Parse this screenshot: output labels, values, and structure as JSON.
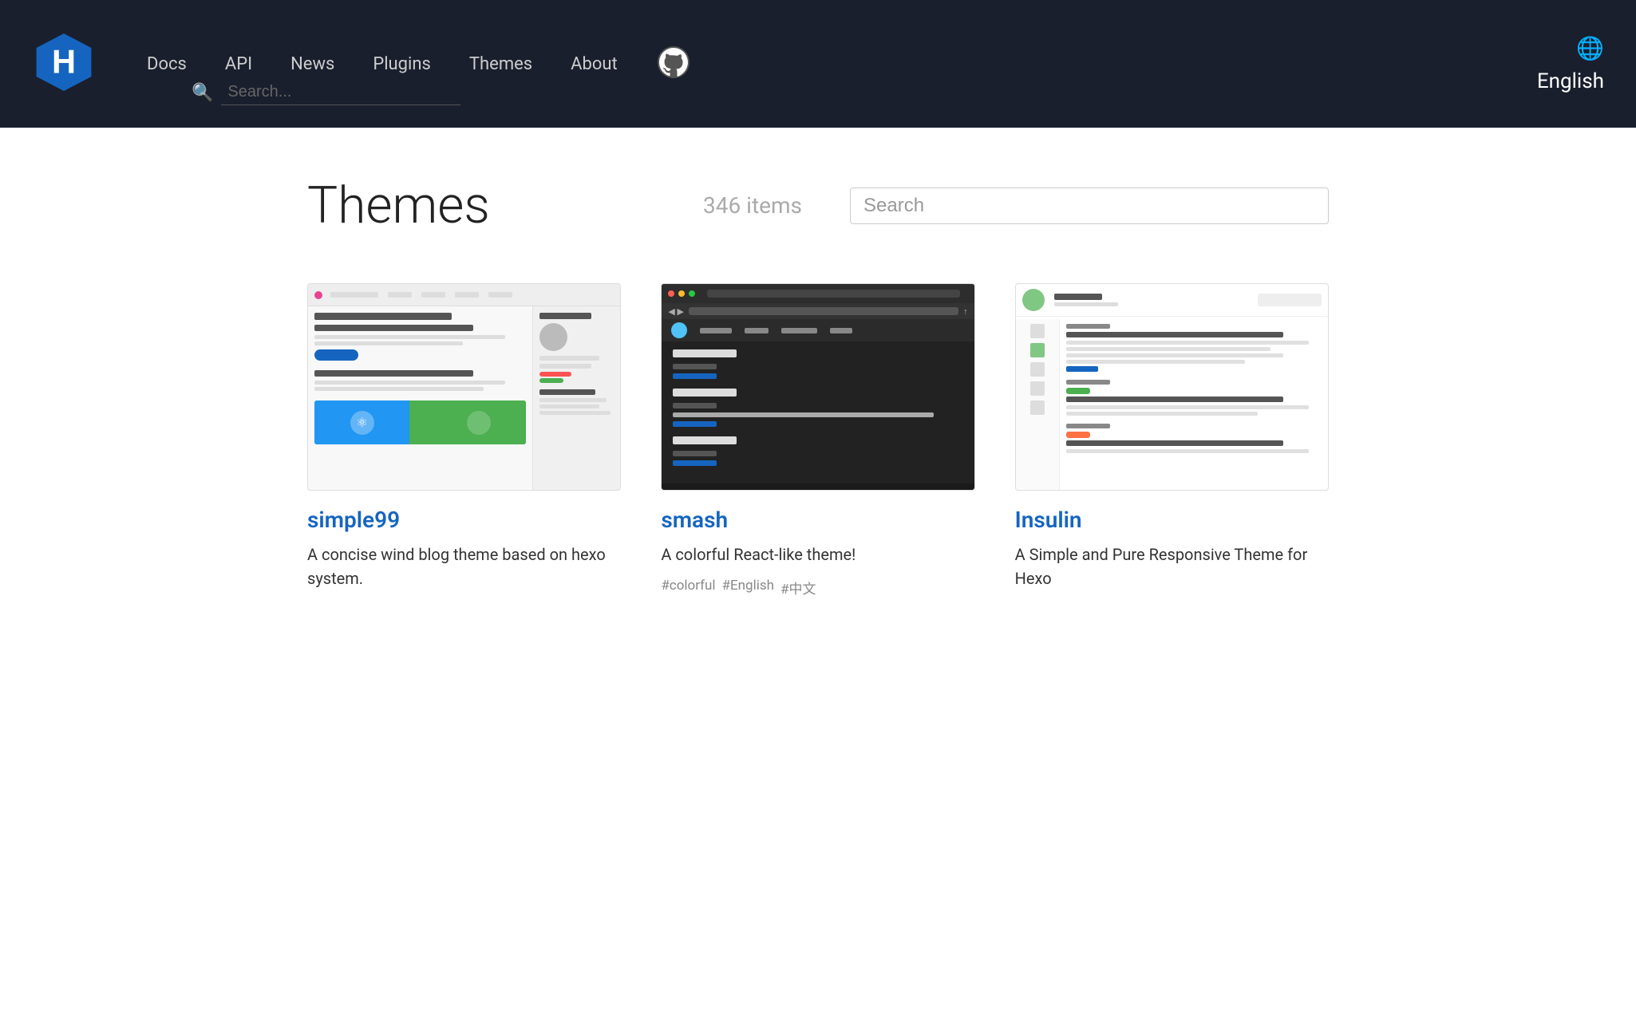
{
  "header": {
    "logo_alt": "Hexo Logo",
    "nav": [
      {
        "label": "Docs",
        "href": "#docs"
      },
      {
        "label": "API",
        "href": "#api"
      },
      {
        "label": "News",
        "href": "#news"
      },
      {
        "label": "Plugins",
        "href": "#plugins"
      },
      {
        "label": "Themes",
        "href": "#themes"
      },
      {
        "label": "About",
        "href": "#about"
      }
    ],
    "search_placeholder": "Search...",
    "github_label": "GitHub",
    "language": "English",
    "globe_icon": "🌐"
  },
  "main": {
    "page_title": "Themes",
    "items_count": "346 items",
    "search_placeholder": "Search",
    "themes": [
      {
        "id": "simple99",
        "name": "simple99",
        "description": "A concise wind blog theme based on hexo system.",
        "tags": []
      },
      {
        "id": "smash",
        "name": "smash",
        "description": "A colorful React-like theme!",
        "tags": [
          "#colorful",
          "#English",
          "#中文"
        ]
      },
      {
        "id": "insulin",
        "name": "Insulin",
        "description": "A Simple and Pure Responsive Theme for Hexo",
        "tags": []
      }
    ]
  }
}
